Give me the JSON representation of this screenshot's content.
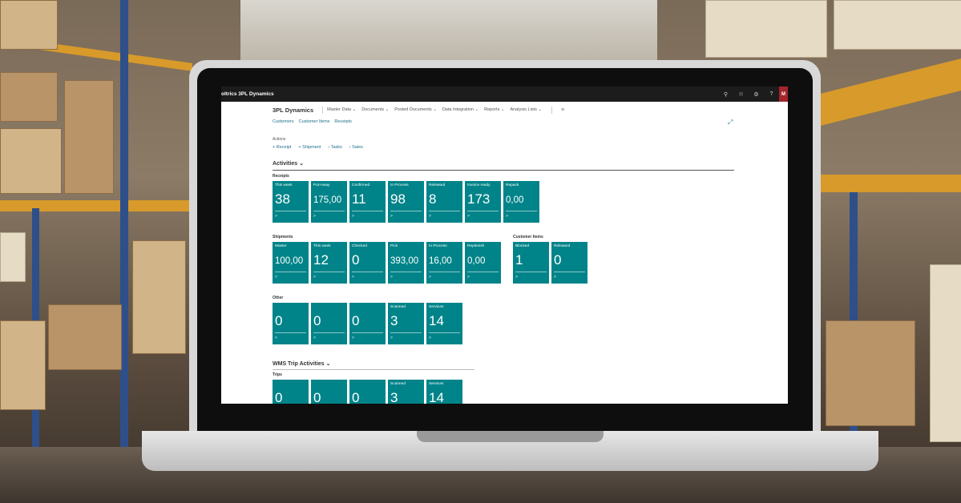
{
  "colors": {
    "tile": "#008489",
    "link": "#1d6f8c",
    "topbar": "#1c1c1c",
    "avatar": "#a4262c"
  },
  "app": {
    "title": "oltrics 3PL Dynamics",
    "avatar_initial": "M"
  },
  "topbar_icons": [
    "search-icon",
    "bell-icon",
    "gear-icon",
    "help-icon"
  ],
  "help_glyph": "?",
  "nav": {
    "brand": "3PL Dynamics",
    "items": [
      "Master Data",
      "Documents",
      "Posted Documents",
      "Data Integration",
      "Reports",
      "Analysis Lists"
    ]
  },
  "quick_links": [
    "Customers",
    "Customer Items",
    "Receipts"
  ],
  "actions": {
    "label": "Actions",
    "items": [
      "Receipt",
      "Shipment",
      "Tasks",
      "Sales"
    ]
  },
  "activities": {
    "title": "Activities",
    "receipts": {
      "label": "Receipts",
      "tiles": [
        {
          "label": "This week",
          "value": "38"
        },
        {
          "label": "Put-Away",
          "value": "175,00"
        },
        {
          "label": "Confirmed",
          "value": "11"
        },
        {
          "label": "In Process",
          "value": "98"
        },
        {
          "label": "Released",
          "value": "8"
        },
        {
          "label": "Invoice ready",
          "value": "173"
        },
        {
          "label": "Repack",
          "value": "0,00"
        }
      ]
    },
    "shipments": {
      "label": "Shipments",
      "tiles": [
        {
          "label": "Master",
          "value": "100,00"
        },
        {
          "label": "This week",
          "value": "12"
        },
        {
          "label": "Checked",
          "value": "0"
        },
        {
          "label": "Pick",
          "value": "393,00"
        },
        {
          "label": "In Process",
          "value": "16,00"
        },
        {
          "label": "Replenish",
          "value": "0,00"
        }
      ]
    },
    "customer_items": {
      "label": "Customer Items",
      "tiles": [
        {
          "label": "Blocked",
          "value": "1"
        },
        {
          "label": "Released",
          "value": "0"
        }
      ]
    },
    "other": {
      "label": "Other",
      "tiles": [
        {
          "label": "",
          "value": "0"
        },
        {
          "label": "",
          "value": "0"
        },
        {
          "label": "",
          "value": "0"
        },
        {
          "label": "Scanned",
          "value": "3"
        },
        {
          "label": "Services",
          "value": "14"
        }
      ]
    }
  },
  "wms": {
    "title": "WMS Trip Activities",
    "trips": {
      "label": "Trips",
      "tiles": [
        {
          "label": "",
          "value": "0"
        },
        {
          "label": "",
          "value": "0"
        },
        {
          "label": "",
          "value": "0"
        },
        {
          "label": "Scanned",
          "value": "3"
        },
        {
          "label": "Services",
          "value": "14"
        }
      ]
    }
  },
  "tile_arrow": ">",
  "plus": "+",
  "chevron": "›"
}
